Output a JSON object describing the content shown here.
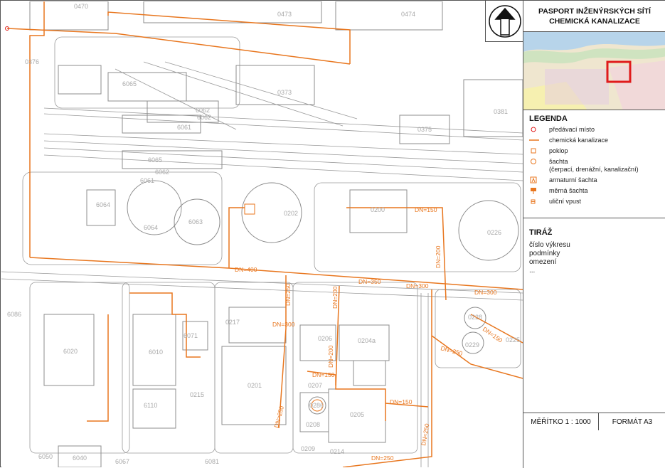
{
  "title": {
    "line1": "PASPORT INŽENÝRSKÝCH SÍTÍ",
    "line2": "CHEMICKÁ KANALIZACE"
  },
  "legend": {
    "heading": "LEGENDA",
    "items": [
      {
        "symbol": "circle-red",
        "label": "předávací místo"
      },
      {
        "symbol": "line-orange",
        "label": "chemická kanalizace"
      },
      {
        "symbol": "square-orange",
        "label": "poklop"
      },
      {
        "symbol": "circle-orange",
        "label": "šachta"
      },
      {
        "symbol": "",
        "label": "(čerpací, drenážní, kanalizační)"
      },
      {
        "symbol": "armature-icon",
        "label": "armaturní šachta"
      },
      {
        "symbol": "meter-icon",
        "label": "měrná šachta"
      },
      {
        "symbol": "drain-icon",
        "label": "uliční vpust"
      }
    ]
  },
  "tiraz": {
    "heading": "TIRÁŽ",
    "lines": [
      "číslo výkresu",
      "podmínky",
      "omezení",
      "..."
    ]
  },
  "footer": {
    "scale": "MĚŘÍTKO 1 : 1000",
    "format": "FORMÁT A3"
  },
  "colors": {
    "pipe": "#e8761e",
    "building_outline": "#8c8c8c",
    "label": "#a9a9a9",
    "highlight": "#e01b1b"
  },
  "map": {
    "parcels": [
      "0470",
      "0473",
      "0474",
      "0376",
      "6065",
      "0373",
      "6062",
      "6062",
      "6061",
      "0381",
      "0375",
      "6065",
      "6062",
      "6061",
      "6064",
      "6064",
      "6063",
      "0202",
      "0200",
      "0226",
      "6086",
      "0217",
      "6071",
      "0228",
      "6020",
      "6010",
      "0206",
      "0204a",
      "0229",
      "0225",
      "0215",
      "0207",
      "0201",
      "0205",
      "6110",
      "0208",
      "0209",
      "0214",
      "6050",
      "6040",
      "6067",
      "6081",
      "0286"
    ],
    "pipe_labels": [
      "DN=150",
      "DN=200",
      "DN=400",
      "DN=350",
      "DN=300",
      "DN=300",
      "DN=250",
      "DN=200",
      "DN=300",
      "DN=150",
      "DN=200",
      "DN=250",
      "DN=150",
      "DN=150",
      "DN=250",
      "DN=250",
      "DN=250"
    ]
  }
}
